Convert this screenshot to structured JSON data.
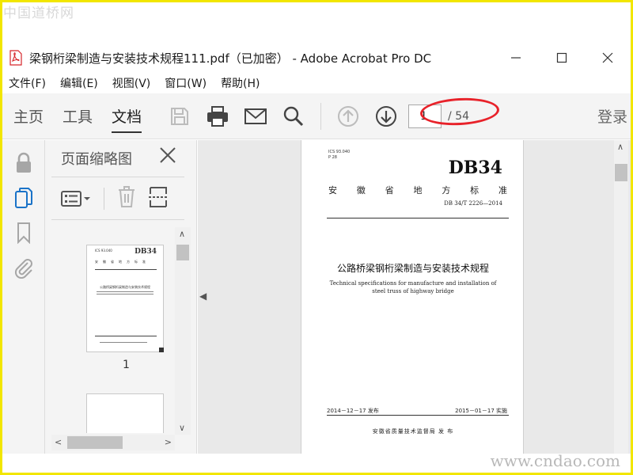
{
  "watermark": {
    "top": "中国道桥网",
    "bottom": "www.cndao.com"
  },
  "window": {
    "title": "梁钢桁梁制造与安装技术规程111.pdf（已加密） - Adobe Acrobat Pro DC",
    "controls": {
      "minimize": "—",
      "maximize": "☐",
      "close": "✕"
    }
  },
  "menu": {
    "items": [
      "文件(F)",
      "编辑(E)",
      "视图(V)",
      "窗口(W)",
      "帮助(H)"
    ]
  },
  "toolbar": {
    "tabs": [
      "主页",
      "工具",
      "文档"
    ],
    "active_tab": "文档",
    "icons": [
      "save-icon",
      "print-icon",
      "email-icon",
      "search-icon",
      "page-up-icon",
      "page-down-icon"
    ],
    "page_current": "1",
    "page_total": "/ 54",
    "login_label": "登录"
  },
  "rail": {
    "icons": [
      "lock-icon",
      "pages-icon",
      "bookmark-icon",
      "attachment-icon"
    ]
  },
  "thumb_panel": {
    "title": "页面缩略图",
    "close": "✕",
    "thumbnails": [
      {
        "label": "1"
      }
    ]
  },
  "document_page": {
    "ics_line1": "ICS 93.040",
    "ics_line2": "P 28",
    "standard": "DB34",
    "province_chars": [
      "安",
      "徽",
      "省",
      "地",
      "方",
      "标",
      "准"
    ],
    "code": "DB 34/T 2226—2014",
    "title_cn": "公路桥梁钢桁梁制造与安装技术规程",
    "title_en": "Technical specifications for manufacture and installation of steel truss of highway bridge",
    "date_issue": "2014－12－17 发布",
    "date_effective": "2015－01－17 实施",
    "issuer": "安徽省质量技术监督局    发 布"
  },
  "colors": {
    "frame": "#f2e600",
    "oval": "#e8222a",
    "toolbar_bg": "#f4f4f4",
    "doc_bg": "#e9e9e9",
    "pdf_red": "#d6262b"
  }
}
